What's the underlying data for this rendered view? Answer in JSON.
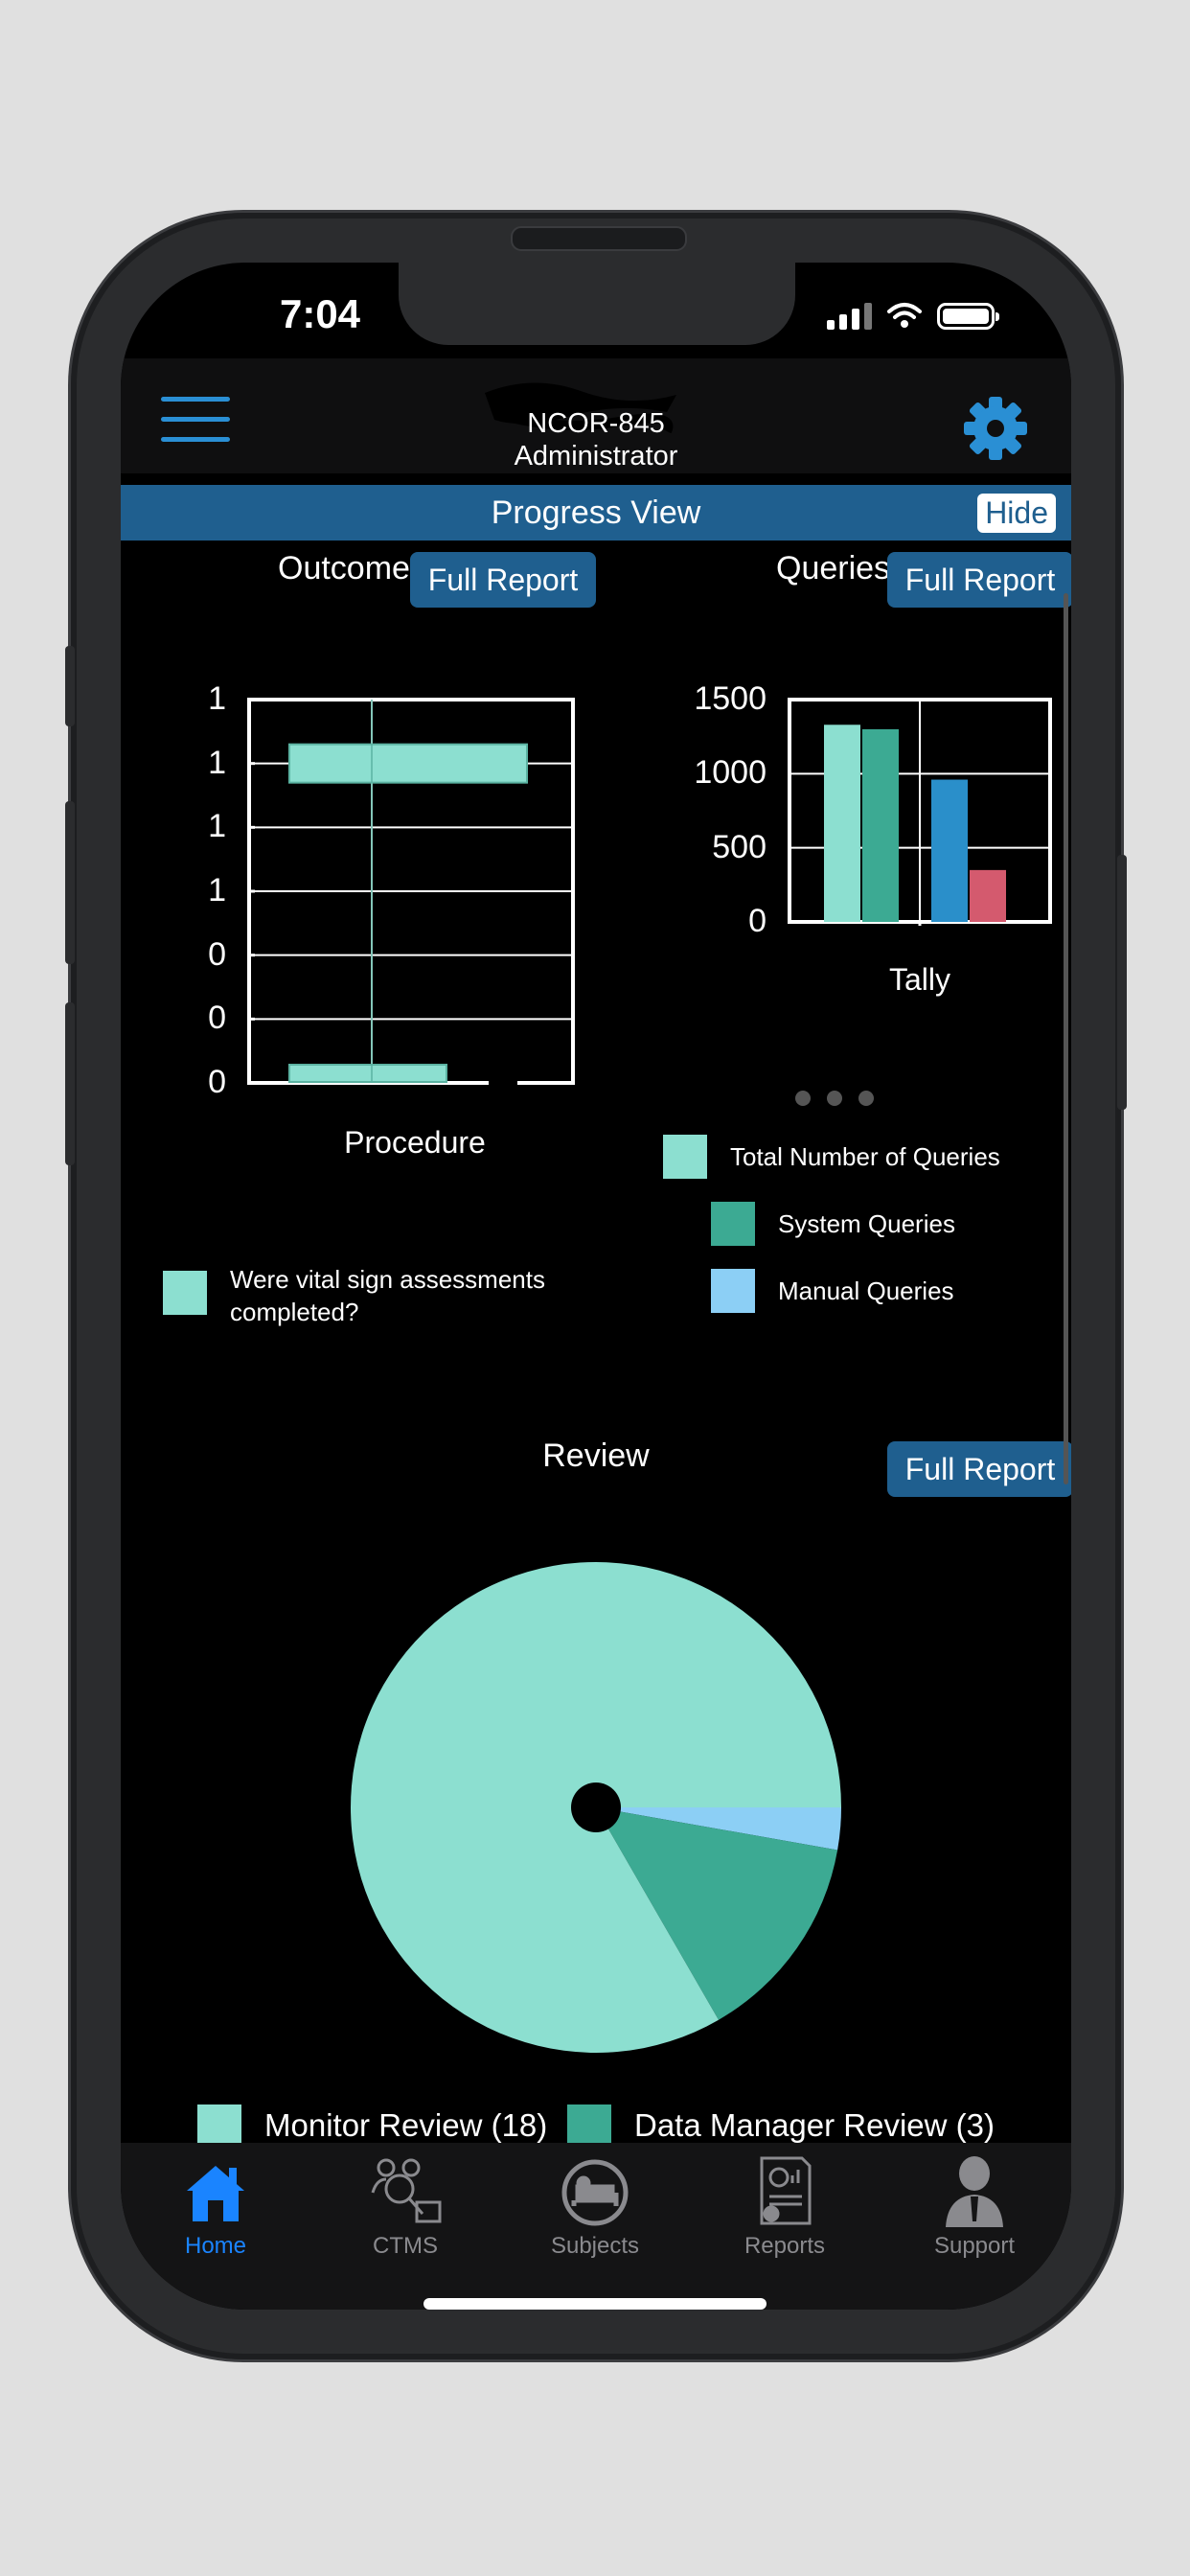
{
  "status_bar": {
    "time": "7:04"
  },
  "header": {
    "project": "NCOR-845",
    "role": "Administrator"
  },
  "progress_view": {
    "title": "Progress View",
    "hide_label": "Hide"
  },
  "outcomes": {
    "title": "Outcomes",
    "full_report_label": "Full Report",
    "chart_data": {
      "type": "bar",
      "orientation": "horizontal",
      "xlabel": "Procedure",
      "y_tick_labels": [
        "1",
        "1",
        "1",
        "1",
        "0",
        "0",
        "0"
      ],
      "series": [
        {
          "name": "Were vital sign assessments completed?",
          "values": [
            1,
            0.06
          ]
        }
      ],
      "legend": "Were vital sign assessments completed?",
      "grid": true,
      "color": "#8cdfd0"
    }
  },
  "queries": {
    "title": "Queries",
    "full_report_label": "Full Report",
    "chart_data": {
      "type": "bar",
      "categories": [
        "Tally"
      ],
      "xlabel": "Tally",
      "ylim": [
        0,
        1500
      ],
      "y_ticks": [
        "1500",
        "1000",
        "500",
        "0"
      ],
      "series": [
        {
          "name": "Total Number of Queries",
          "values": [
            1330
          ],
          "color": "#8cdfd0"
        },
        {
          "name": "System Queries",
          "values": [
            1300
          ],
          "color": "#3caa93"
        },
        {
          "name": "",
          "values": [
            960
          ],
          "color": "#2a8fca"
        },
        {
          "name": "",
          "values": [
            350
          ],
          "color": "#d45a6e"
        }
      ],
      "legend": [
        "Total Number of Queries",
        "System Queries",
        "Manual Queries"
      ],
      "legend_colors": [
        "#8cdfd0",
        "#3caa93",
        "#8ccff5"
      ],
      "grid": true
    },
    "pager_dots": 3
  },
  "review": {
    "title": "Review",
    "full_report_label": "Full Report",
    "chart_data": {
      "type": "pie",
      "slices": [
        {
          "name": "Monitor Review (18)",
          "value": 18,
          "color": "#8cdfd0"
        },
        {
          "name": "Data Manager Review (3)",
          "value": 3,
          "color": "#3caa93"
        },
        {
          "name": "",
          "value": 0.6,
          "color": "#8ccff5"
        }
      ],
      "legend": [
        "Monitor Review (18)",
        "Data Manager Review (3)"
      ]
    }
  },
  "tabbar": {
    "items": [
      {
        "label": "Home",
        "icon": "home-icon",
        "active": true
      },
      {
        "label": "CTMS",
        "icon": "ctms-icon",
        "active": false
      },
      {
        "label": "Subjects",
        "icon": "subjects-icon",
        "active": false
      },
      {
        "label": "Reports",
        "icon": "reports-icon",
        "active": false
      },
      {
        "label": "Support",
        "icon": "support-icon",
        "active": false
      }
    ]
  },
  "colors": {
    "accent": "#1f5f8f",
    "tab_active": "#1a84ff",
    "teal_light": "#8cdfd0",
    "teal_dark": "#3caa93"
  }
}
